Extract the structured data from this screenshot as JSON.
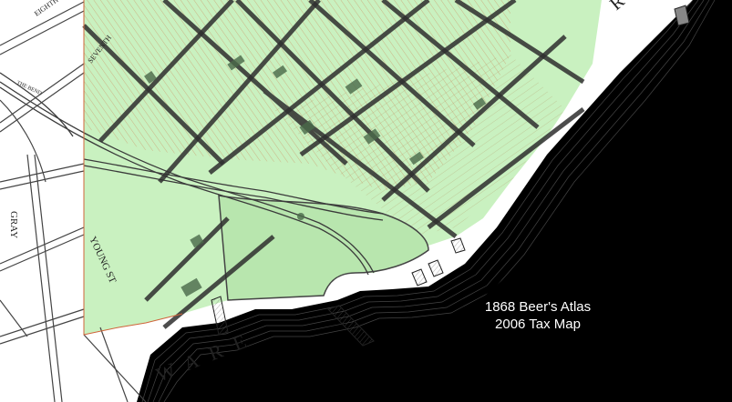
{
  "caption": {
    "line1": "1868 Beer's Atlas",
    "line2": "2006 Tax Map"
  },
  "map_labels": {
    "river": "WARE",
    "river_corner": "R",
    "gray_street": "GRAY",
    "young_street": "YOUNG ST",
    "eighth_street": "EIGHTH",
    "seventh_street": "SEVENTH",
    "the_bend": "THE BEND"
  },
  "colors": {
    "overlay": "#c6f0bd",
    "water": "#000000",
    "paper": "#ffffff",
    "parcel_line": "#d0643a",
    "street_line": "#333333"
  }
}
